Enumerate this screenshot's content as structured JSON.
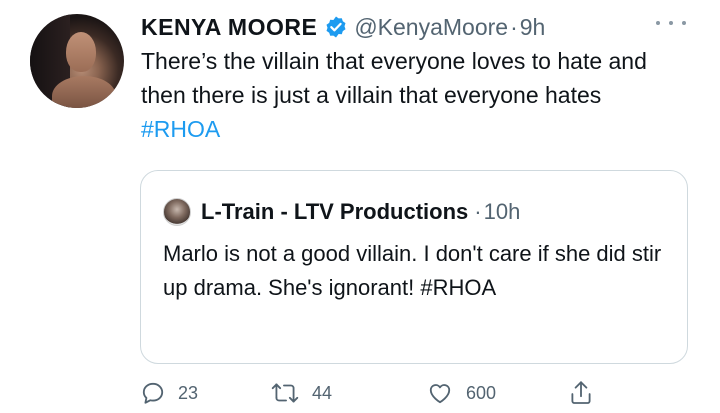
{
  "tweet": {
    "author_name": "KENYA MOORE",
    "handle": "@KenyaMoore",
    "separator": "·",
    "time": "9h",
    "text_before": "There’s the villain that everyone loves to hate and then there is just a villain that everyone hates ",
    "hashtag": "#RHOA",
    "verified_icon": "verified-badge-icon",
    "more_icon": "more-options-icon"
  },
  "quote": {
    "author_name": "L-Train - LTV Productions",
    "separator": "·",
    "time": "10h",
    "text": "Marlo is not a good villain. I don't care if she did stir up drama. She's ignorant! #RHOA"
  },
  "actions": {
    "reply_count": "23",
    "retweet_count": "44",
    "like_count": "600"
  },
  "colors": {
    "accent": "#1d9bf0",
    "muted": "#536471",
    "text": "#0f1419",
    "border": "#cfd9de"
  }
}
